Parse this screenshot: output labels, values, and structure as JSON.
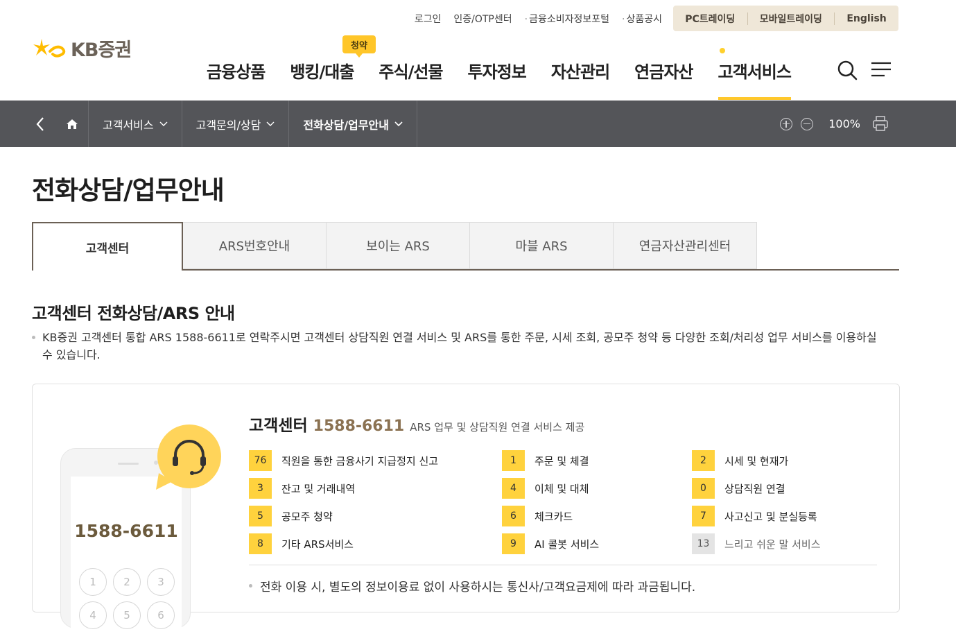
{
  "brand": {
    "name": "KB증권"
  },
  "util_links": [
    "로그인",
    "인증/OTP센터",
    "금융소비자정보포털",
    "상품공시"
  ],
  "trade_links": [
    "PC트레이딩",
    "모바일트레이딩",
    "English"
  ],
  "gnb": {
    "badge": "청약",
    "items": [
      "금융상품",
      "뱅킹/대출",
      "주식/선물",
      "투자정보",
      "자산관리",
      "연금자산",
      "고객서비스"
    ]
  },
  "location": {
    "crumbs": [
      "고객서비스",
      "고객문의/상담",
      "전화상담/업무안내"
    ],
    "zoom": "100%"
  },
  "page": {
    "title": "전화상담/업무안내",
    "tabs": [
      "고객센터",
      "ARS번호안내",
      "보이는 ARS",
      "마블 ARS",
      "연금자산관리센터"
    ],
    "section_title": "고객센터 전화상담/ARS 안내",
    "description": "KB증권 고객센터 통합 ARS 1588-6611로 연락주시면 고객센터 상담직원 연결 서비스 및 ARS를 통한 주문, 시세 조회, 공모주 청약 등 다양한 조회/처리성 업무 서비스를 이용하실 수 있습니다."
  },
  "card": {
    "phone_number": "1588-6611",
    "keys": [
      "1",
      "2",
      "3",
      "4",
      "5",
      "6"
    ],
    "head_title": "고객센터",
    "head_number": "1588-6611",
    "head_desc": "ARS 업무 및 상담직원 연결 서비스 제공",
    "menu": [
      [
        {
          "num": "76",
          "label": "직원을 통한 금융사기 지급정지 신고"
        },
        {
          "num": "1",
          "label": "주문 및 체결"
        },
        {
          "num": "2",
          "label": "시세 및 현재가"
        }
      ],
      [
        {
          "num": "3",
          "label": "잔고 및 거래내역"
        },
        {
          "num": "4",
          "label": "이체 및 대체"
        },
        {
          "num": "0",
          "label": "상담직원 연결"
        }
      ],
      [
        {
          "num": "5",
          "label": "공모주 청약"
        },
        {
          "num": "6",
          "label": "체크카드"
        },
        {
          "num": "7",
          "label": "사고신고 및 분실등록"
        }
      ],
      [
        {
          "num": "8",
          "label": "기타 ARS서비스"
        },
        {
          "num": "9",
          "label": "AI 콜봇 서비스"
        },
        {
          "num": "13",
          "label": "느리고 쉬운 말 서비스"
        }
      ]
    ],
    "note": "전화 이용 시, 별도의 정보이용료 없이 사용하시는 통신사/고객요금제에 따라 과금됩니다."
  },
  "colors": {
    "accent": "#ffc82c",
    "brown": "#8b7252",
    "locbar": "#545559"
  }
}
